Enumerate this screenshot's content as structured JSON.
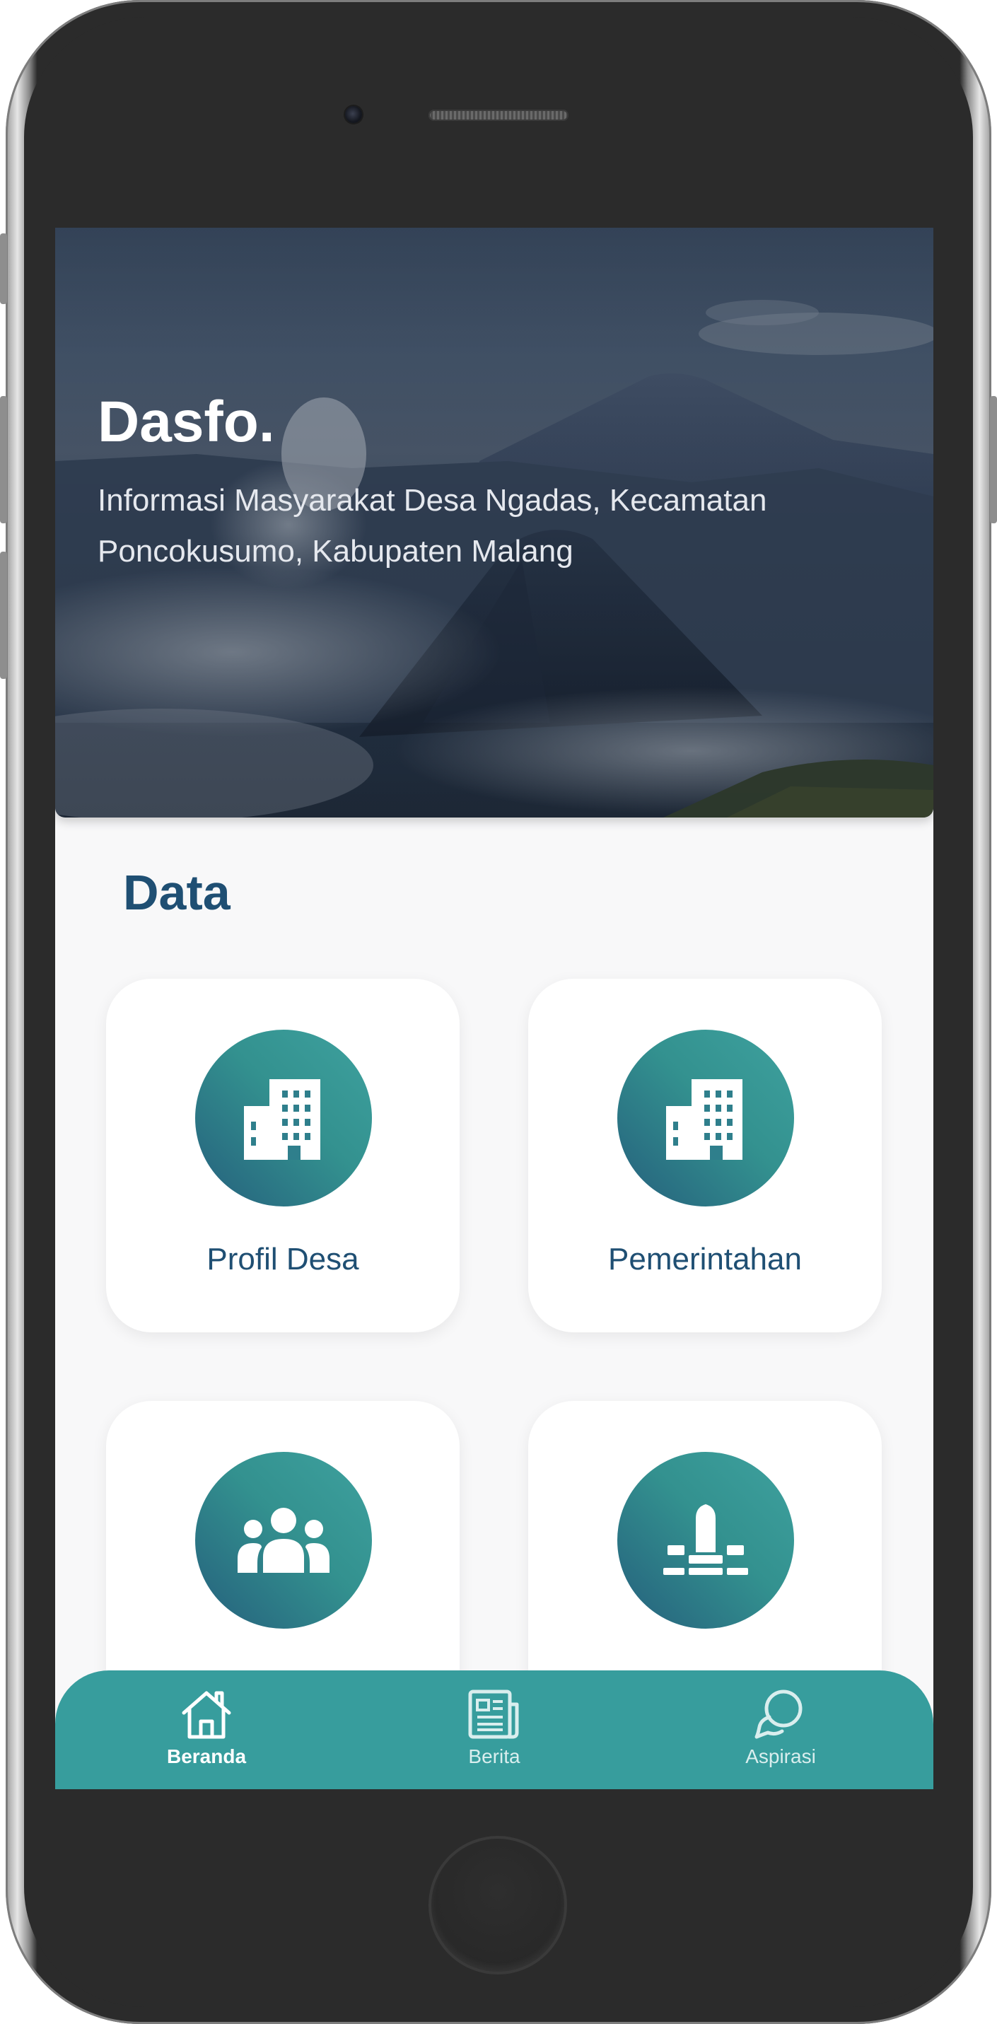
{
  "hero": {
    "title": "Dasfo.",
    "subtitle": "Informasi Masyarakat Desa Ngadas, Kecamatan Poncokusumo, Kabupaten Malang"
  },
  "data_section": {
    "title": "Data",
    "cards": [
      {
        "label": "Profil Desa",
        "icon": "building-icon"
      },
      {
        "label": "Pemerintahan",
        "icon": "building-icon"
      },
      {
        "label": "",
        "icon": "people-group-icon"
      },
      {
        "label": "",
        "icon": "monument-icon"
      }
    ]
  },
  "bottom_nav": {
    "items": [
      {
        "label": "Beranda",
        "icon": "home-icon",
        "active": true
      },
      {
        "label": "Berita",
        "icon": "newspaper-icon",
        "active": false
      },
      {
        "label": "Aspirasi",
        "icon": "chat-bubbles-icon",
        "active": false
      }
    ]
  },
  "colors": {
    "accent": "#379d9d",
    "title_blue": "#1f4f73",
    "icon_gradient_start": "#3ea19e",
    "icon_gradient_end": "#255f7c"
  }
}
